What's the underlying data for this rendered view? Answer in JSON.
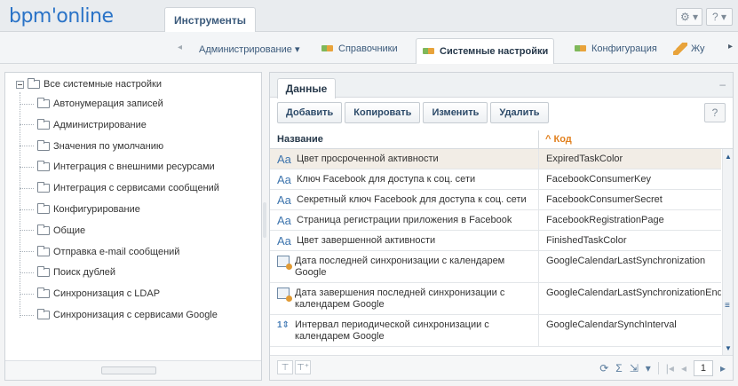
{
  "app": {
    "logo": "bpm'online",
    "top_tab": "Инструменты",
    "top_icons": [
      "gear-icon",
      "help-icon"
    ]
  },
  "subnav": {
    "items": [
      {
        "label": "Администрирование ▾",
        "icon": "none",
        "active": false
      },
      {
        "label": "Справочники",
        "icon": "puzzle-icon",
        "active": false
      },
      {
        "label": "Системные настройки",
        "icon": "puzzle-icon",
        "active": true
      },
      {
        "label": "Конфигурация",
        "icon": "puzzle-icon",
        "active": false
      },
      {
        "label": "Жу",
        "icon": "pen-icon",
        "active": false
      }
    ]
  },
  "tree": {
    "root": "Все системные настройки",
    "items": [
      "Автонумерация записей",
      "Администрирование",
      "Значения по умолчанию",
      "Интеграция с внешними ресурсами",
      "Интеграция с сервисами сообщений",
      "Конфигурирование",
      "Общие",
      "Отправка e-mail сообщений",
      "Поиск дублей",
      "Синхронизация с LDAP",
      "Синхронизация с сервисами Google"
    ]
  },
  "panel": {
    "tab": "Данные",
    "minimize": "–",
    "actions": [
      "Добавить",
      "Копировать",
      "Изменить",
      "Удалить"
    ],
    "columns": {
      "name": "Название",
      "code": "^ Код"
    },
    "rows": [
      {
        "type": "text",
        "name": "Цвет просроченной активности",
        "code": "ExpiredTaskColor",
        "selected": true
      },
      {
        "type": "text",
        "name": "Ключ Facebook для доступа к соц. сети",
        "code": "FacebookConsumerKey"
      },
      {
        "type": "text",
        "name": "Секретный ключ Facebook для доступа к соц. сети",
        "code": "FacebookConsumerSecret"
      },
      {
        "type": "text",
        "name": "Страница регистрации приложения в Facebook",
        "code": "FacebookRegistrationPage"
      },
      {
        "type": "text",
        "name": "Цвет завершенной активности",
        "code": "FinishedTaskColor"
      },
      {
        "type": "date",
        "name": "Дата последней синхронизации с календарем Google",
        "code": "GoogleCalendarLastSynchronization"
      },
      {
        "type": "date",
        "name": "Дата завершения последней синхронизации с календарем Google",
        "code": "GoogleCalendarLastSynchronizationEnd"
      },
      {
        "type": "int",
        "name": "Интервал периодической синхронизации с календарем Google",
        "code": "GoogleCalendarSynchInterval"
      }
    ],
    "type_glyph_text": "Aa",
    "type_glyph_int": "1⇕",
    "page_number": "1"
  }
}
